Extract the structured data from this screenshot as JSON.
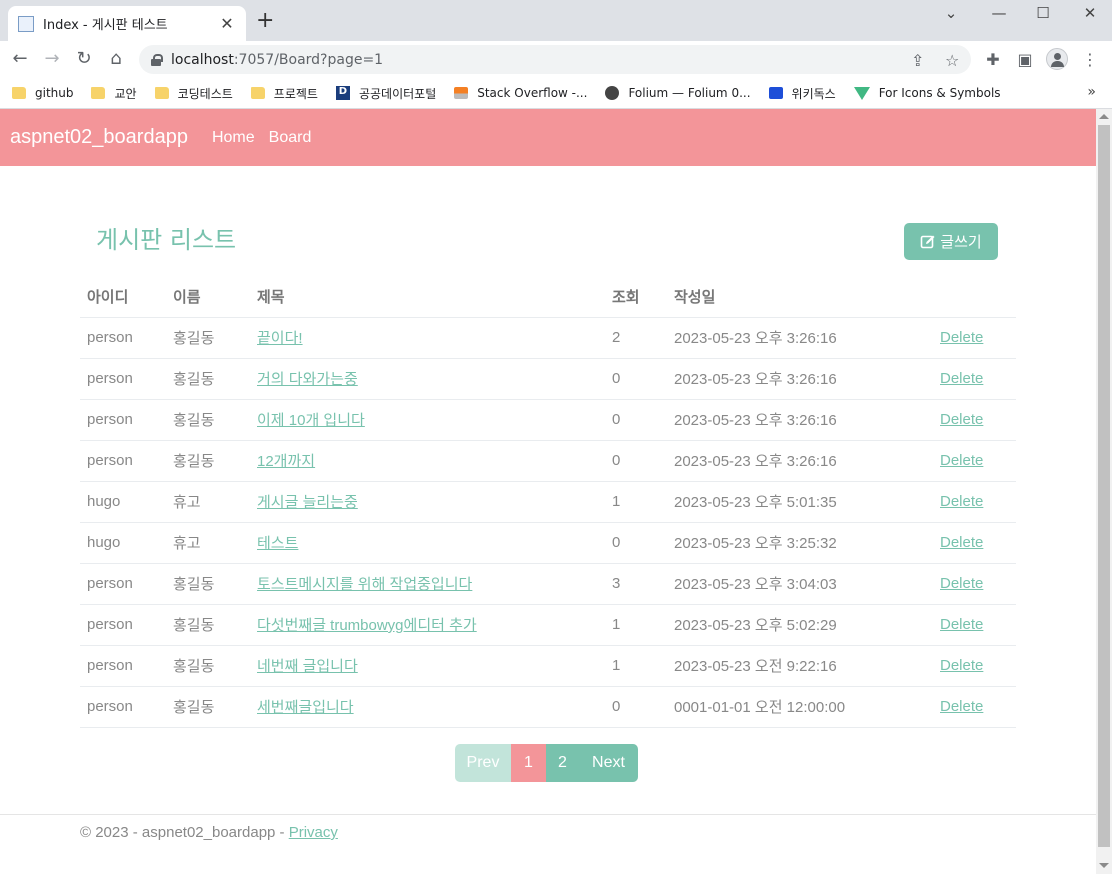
{
  "browser": {
    "tab_title": "Index - 게시판 테스트",
    "url_host": "localhost",
    "url_path": ":7057/Board?page=1",
    "bookmarks": [
      {
        "label": "github",
        "icon": "folder-icon"
      },
      {
        "label": "교안",
        "icon": "folder-icon"
      },
      {
        "label": "코딩테스트",
        "icon": "folder-icon"
      },
      {
        "label": "프로젝트",
        "icon": "folder-icon"
      },
      {
        "label": "공공데이터포털",
        "icon": "data-portal-icon"
      },
      {
        "label": "Stack Overflow -...",
        "icon": "stackoverflow-icon"
      },
      {
        "label": "Folium — Folium 0...",
        "icon": "globe-icon"
      },
      {
        "label": "위키독스",
        "icon": "wikidocs-icon"
      },
      {
        "label": "For Icons & Symbols",
        "icon": "vue-icon"
      }
    ]
  },
  "navbar": {
    "brand": "aspnet02_boardapp",
    "links": [
      "Home",
      "Board"
    ]
  },
  "page": {
    "heading": "게시판 리스트",
    "write_button": "글쓰기"
  },
  "table": {
    "headers": [
      "아이디",
      "이름",
      "제목",
      "조회",
      "작성일"
    ],
    "rows": [
      {
        "id": "person",
        "name": "홍길동",
        "title": "끝이다!",
        "views": "2",
        "date": "2023-05-23 오후 3:26:16",
        "action": "Delete"
      },
      {
        "id": "person",
        "name": "홍길동",
        "title": "거의 다와가는중",
        "views": "0",
        "date": "2023-05-23 오후 3:26:16",
        "action": "Delete"
      },
      {
        "id": "person",
        "name": "홍길동",
        "title": "이제 10개 입니다",
        "views": "0",
        "date": "2023-05-23 오후 3:26:16",
        "action": "Delete"
      },
      {
        "id": "person",
        "name": "홍길동",
        "title": "12개까지",
        "views": "0",
        "date": "2023-05-23 오후 3:26:16",
        "action": "Delete"
      },
      {
        "id": "hugo",
        "name": "휴고",
        "title": "게시글 늘리는중",
        "views": "1",
        "date": "2023-05-23 오후 5:01:35",
        "action": "Delete"
      },
      {
        "id": "hugo",
        "name": "휴고",
        "title": "테스트",
        "views": "0",
        "date": "2023-05-23 오후 3:25:32",
        "action": "Delete"
      },
      {
        "id": "person",
        "name": "홍길동",
        "title": "토스트메시지를 위해 작업중입니다",
        "views": "3",
        "date": "2023-05-23 오후 3:04:03",
        "action": "Delete"
      },
      {
        "id": "person",
        "name": "홍길동",
        "title": "다섯번째글 trumbowyg에디터 추가",
        "views": "1",
        "date": "2023-05-23 오후 5:02:29",
        "action": "Delete"
      },
      {
        "id": "person",
        "name": "홍길동",
        "title": "네번째 글입니다",
        "views": "1",
        "date": "2023-05-23 오전 9:22:16",
        "action": "Delete"
      },
      {
        "id": "person",
        "name": "홍길동",
        "title": "세번째글입니다",
        "views": "0",
        "date": "0001-01-01 오전 12:00:00",
        "action": "Delete"
      }
    ]
  },
  "pagination": {
    "prev": "Prev",
    "pages": [
      "1",
      "2"
    ],
    "next": "Next",
    "current": "1"
  },
  "footer": {
    "text": "© 2023 - aspnet02_boardapp - ",
    "privacy": "Privacy"
  },
  "colors": {
    "navbar": "#f39599",
    "primary": "#78c2ad",
    "primary_disabled": "#c2e4da",
    "active_page": "#f39599"
  }
}
